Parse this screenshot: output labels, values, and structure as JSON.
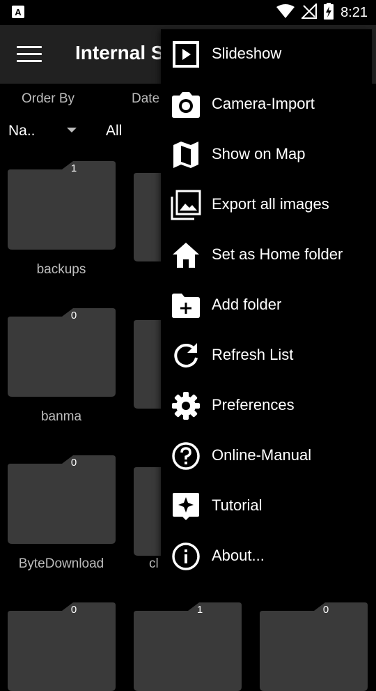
{
  "status": {
    "time": "8:21",
    "icons": [
      "notification-a-icon",
      "wifi-icon",
      "no-signal-icon",
      "battery-charging-icon"
    ]
  },
  "app_bar": {
    "title": "Internal S"
  },
  "filters": {
    "order_by_label": "Order By",
    "order_by_value": "Na..",
    "date_label": "Date",
    "date_value": "All"
  },
  "folders": [
    {
      "name": "backups",
      "count": "1"
    },
    {
      "name": "banma",
      "count": "0"
    },
    {
      "name": "ByteDownload",
      "count": "0"
    },
    {
      "name": "cl",
      "count": ""
    },
    {
      "name": "",
      "count": "0"
    },
    {
      "name": "",
      "count": "1"
    },
    {
      "name": "",
      "count": "0"
    }
  ],
  "menu": {
    "items": [
      {
        "label": "Slideshow",
        "icon": "slideshow-icon"
      },
      {
        "label": "Camera-Import",
        "icon": "camera-icon"
      },
      {
        "label": "Show on Map",
        "icon": "map-icon"
      },
      {
        "label": "Export all images",
        "icon": "photo-library-icon"
      },
      {
        "label": "Set as Home folder",
        "icon": "home-icon"
      },
      {
        "label": "Add folder",
        "icon": "add-folder-icon"
      },
      {
        "label": "Refresh List",
        "icon": "refresh-icon"
      },
      {
        "label": "Preferences",
        "icon": "gear-icon"
      },
      {
        "label": "Online-Manual",
        "icon": "help-icon"
      },
      {
        "label": "Tutorial",
        "icon": "tutorial-icon"
      },
      {
        "label": "About...",
        "icon": "info-icon"
      }
    ]
  }
}
